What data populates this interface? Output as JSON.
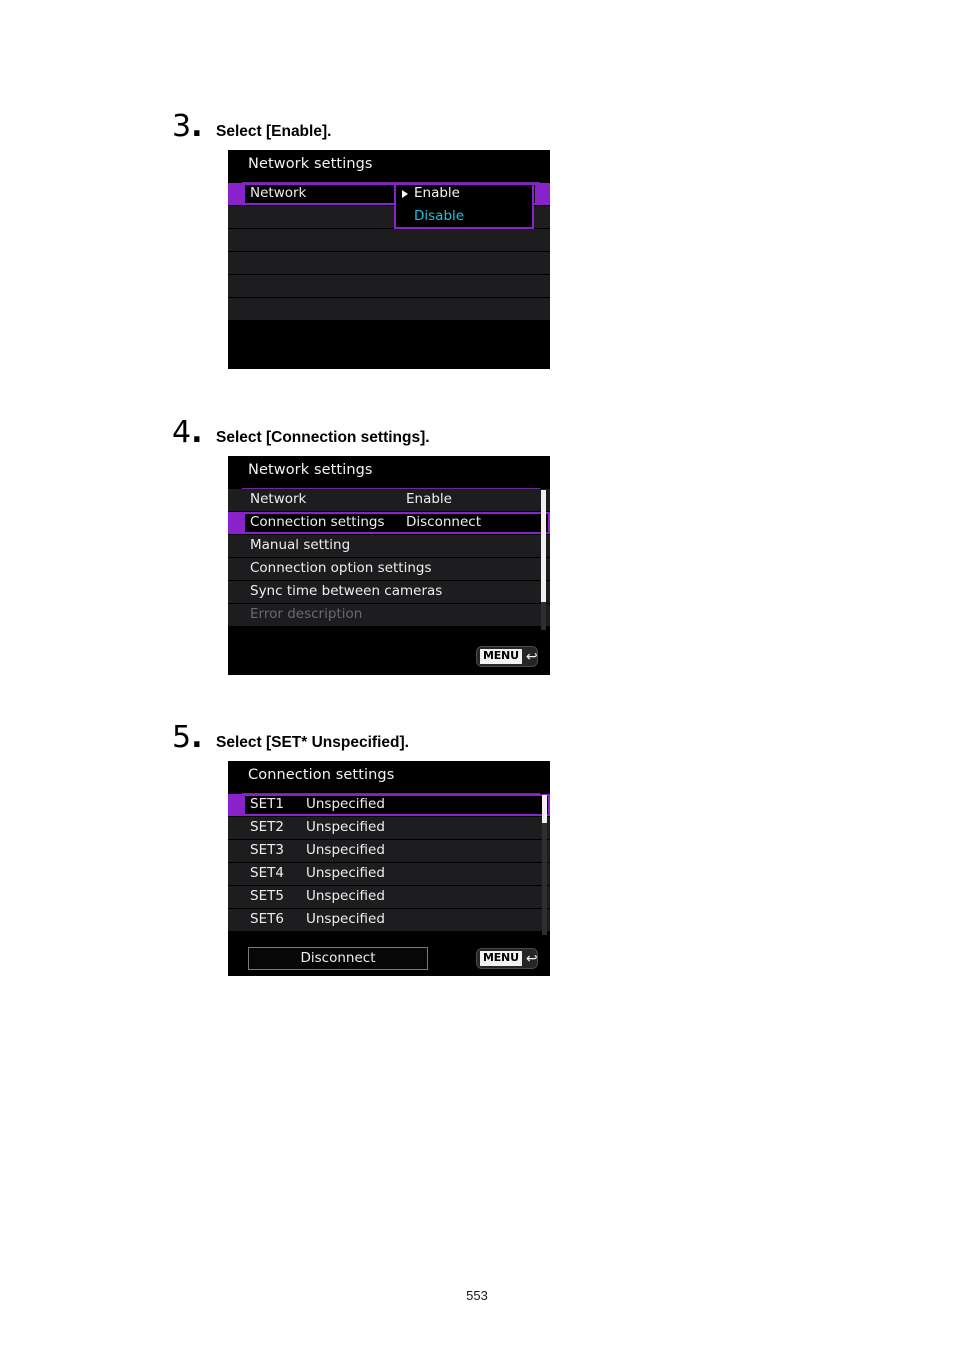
{
  "page": {
    "number": "553"
  },
  "steps": [
    {
      "number": "3",
      "dot": ".",
      "title": "Select [Enable].",
      "screen": {
        "title": "Network settings",
        "rows": [
          {
            "label": "Network",
            "value": ""
          },
          {
            "label": "",
            "value": ""
          },
          {
            "label": "",
            "value": ""
          },
          {
            "label": "",
            "value": ""
          },
          {
            "label": "",
            "value": ""
          },
          {
            "label": "",
            "value": ""
          }
        ],
        "dropdown": {
          "current": "Enable",
          "alternate": "Disable"
        }
      }
    },
    {
      "number": "4",
      "dot": ".",
      "title": "Select [Connection settings].",
      "screen": {
        "title": "Network settings",
        "rows": [
          {
            "label": "Network",
            "value": "Enable"
          },
          {
            "label": "Connection settings",
            "value": "Disconnect"
          },
          {
            "label": "Manual setting",
            "value": ""
          },
          {
            "label": "Connection option settings",
            "value": ""
          },
          {
            "label": "Sync time between cameras",
            "value": ""
          },
          {
            "label": "Error description",
            "value": ""
          }
        ],
        "menu_button": {
          "label": "MENU",
          "arrow": "↩"
        }
      }
    },
    {
      "number": "5",
      "dot": ".",
      "title": "Select [SET* Unspecified].",
      "screen": {
        "title": "Connection settings",
        "rows": [
          {
            "label": "SET1",
            "value": "Unspecified"
          },
          {
            "label": "SET2",
            "value": "Unspecified"
          },
          {
            "label": "SET3",
            "value": "Unspecified"
          },
          {
            "label": "SET4",
            "value": "Unspecified"
          },
          {
            "label": "SET5",
            "value": "Unspecified"
          },
          {
            "label": "SET6",
            "value": "Unspecified"
          }
        ],
        "disconnect_button": "Disconnect",
        "menu_button": {
          "label": "MENU",
          "arrow": "↩"
        }
      }
    }
  ],
  "colors": {
    "accent_purple": "#8a22cc",
    "cyan_text": "#1fc0e2",
    "screen_bg": "#000000",
    "row_bg": "#1d1d1f"
  }
}
